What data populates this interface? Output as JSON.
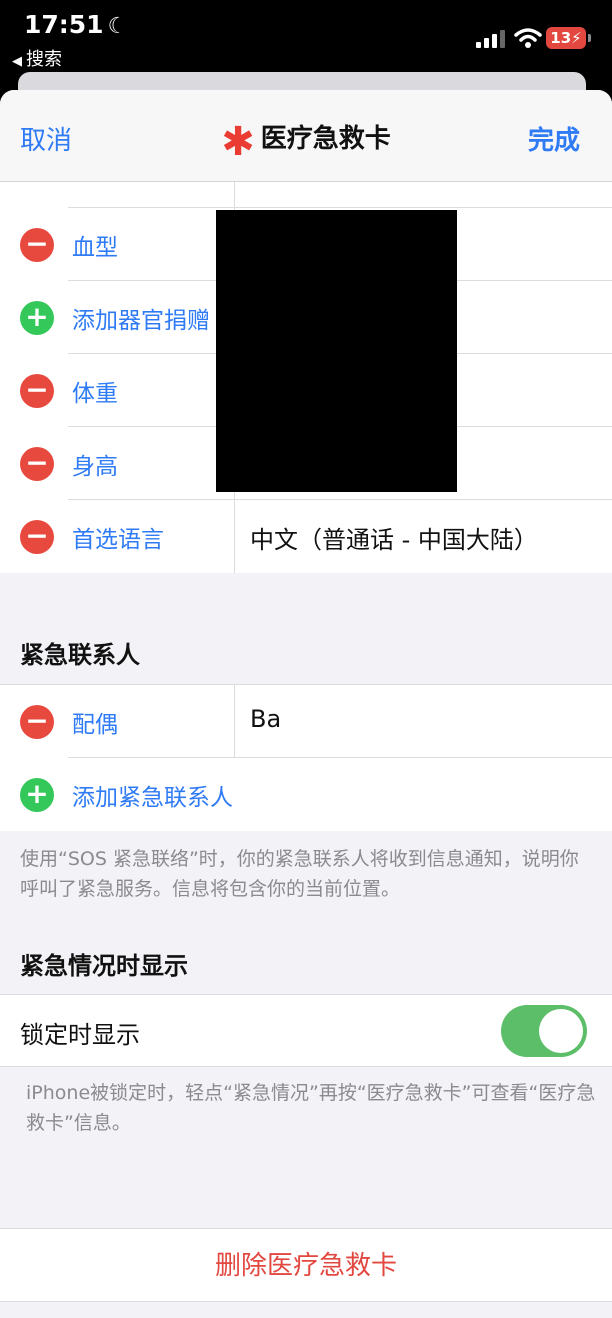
{
  "status_bar": {
    "time": "17:51",
    "back_app": "搜索",
    "battery": "13"
  },
  "nav": {
    "cancel": "取消",
    "title": "医疗急救卡",
    "done": "完成"
  },
  "medical_rows": [
    {
      "label": "血型",
      "value": "",
      "control": "minus"
    },
    {
      "label": "添加器官捐赠",
      "value": "",
      "control": "plus"
    },
    {
      "label": "体重",
      "value": "",
      "control": "minus"
    },
    {
      "label": "身高",
      "value": "",
      "control": "minus"
    },
    {
      "label": "首选语言",
      "value": "中文（普通话 - 中国大陆）",
      "control": "minus"
    }
  ],
  "emergency_contacts": {
    "header": "紧急联系人",
    "contact_label": "配偶",
    "contact_value": "Ba",
    "add_label": "添加紧急联系人",
    "footnote": "使用“SOS 紧急联络”时，你的紧急联系人将收到信息通知，说明你呼叫了紧急服务。信息将包含你的当前位置。"
  },
  "show_when_locked": {
    "header": "紧急情况时显示",
    "row_label": "锁定时显示",
    "toggle_on": true,
    "footnote": "iPhone被锁定时，轻点“紧急情况”再按“医疗急救卡”可查看“医疗急救卡”信息。"
  },
  "delete_label": "删除医疗急救卡",
  "colors": {
    "accent": "#2f7bf5",
    "destructive": "#e24840",
    "add": "#34c759",
    "toggle": "#5cbe68"
  }
}
